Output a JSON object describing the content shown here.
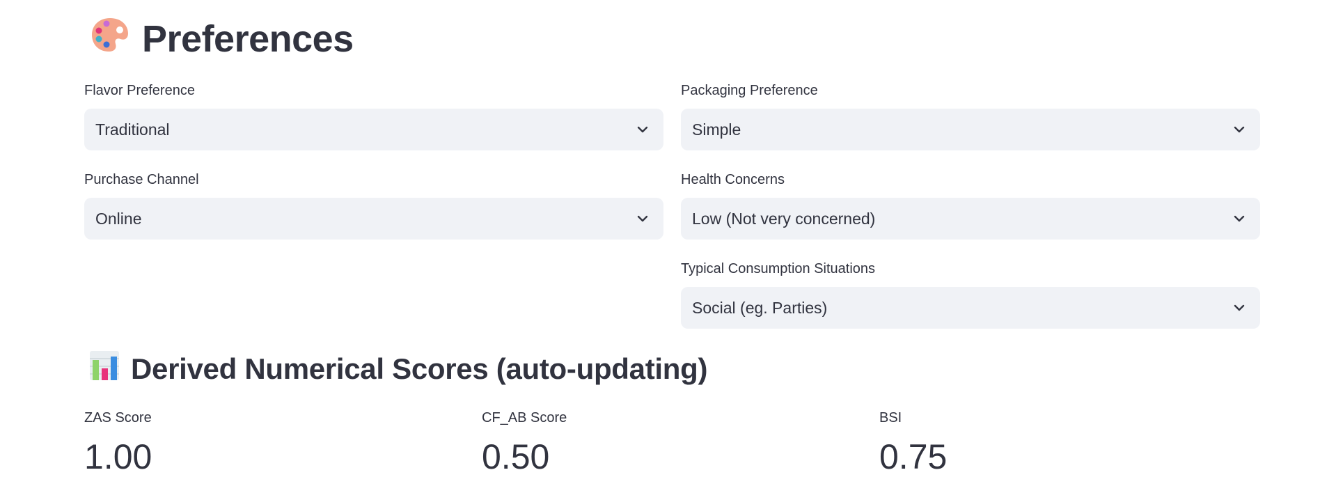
{
  "preferences": {
    "title": "Preferences",
    "title_icon": "artist-palette-icon",
    "fields": {
      "flavor": {
        "label": "Flavor Preference",
        "value": "Traditional"
      },
      "packaging": {
        "label": "Packaging Preference",
        "value": "Simple"
      },
      "channel": {
        "label": "Purchase Channel",
        "value": "Online"
      },
      "health": {
        "label": "Health Concerns",
        "value": "Low (Not very concerned)"
      },
      "situations": {
        "label": "Typical Consumption Situations",
        "value": "Social (eg. Parties)"
      }
    }
  },
  "scores": {
    "title": "Derived Numerical Scores (auto-updating)",
    "title_icon": "bar-chart-icon",
    "zas": {
      "label": "ZAS Score",
      "value": "1.00"
    },
    "cfab": {
      "label": "CF_AB Score",
      "value": "0.50"
    },
    "bsi": {
      "label": "BSI",
      "value": "0.75"
    }
  },
  "colors": {
    "text": "#31333f",
    "select_background": "#f0f2f6"
  }
}
